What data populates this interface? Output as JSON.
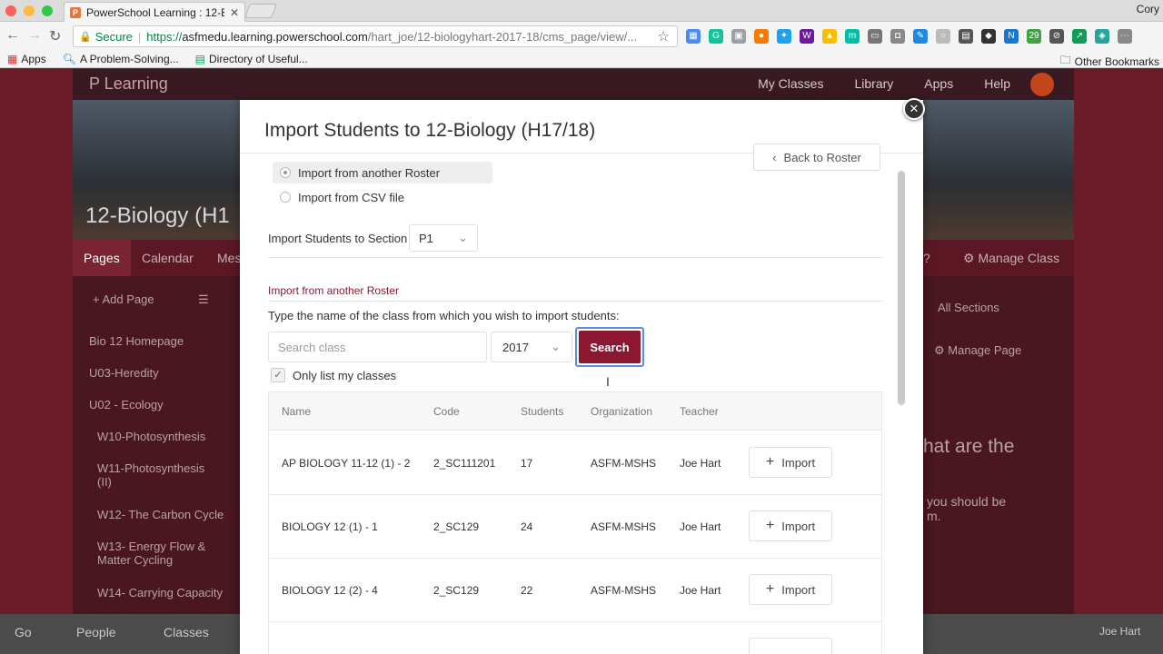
{
  "browser": {
    "tab_title": "PowerSchool Learning : 12-Bi",
    "tab_favicon": "P",
    "user": "Cory",
    "secure_label": "Secure",
    "url_proto": "https://",
    "url_host": "asfmedu.learning.powerschool.com",
    "url_path": "/hart_joe/12-biologyhart-2017-18/cms_page/view/...",
    "bookmarks": [
      "Apps",
      "A Problem-Solving...",
      "Directory of Useful..."
    ],
    "other_bookmarks": "Other Bookmarks",
    "extensions": [
      {
        "icon": "calendar-ext-icon",
        "color": "#4a8af4",
        "glyph": "▦"
      },
      {
        "icon": "grammarly-icon",
        "color": "#15c39a",
        "glyph": "G"
      },
      {
        "icon": "ext-grey-icon",
        "color": "#9aa0a6",
        "glyph": "▣"
      },
      {
        "icon": "ext-orange-icon",
        "color": "#f57c00",
        "glyph": "●"
      },
      {
        "icon": "twitter-icon",
        "color": "#1da1f2",
        "glyph": "✦"
      },
      {
        "icon": "ext-purple-icon",
        "color": "#6a1b9a",
        "glyph": "W"
      },
      {
        "icon": "drive-icon",
        "color": "#fbbc04",
        "glyph": "▲"
      },
      {
        "icon": "ext-teal-icon",
        "color": "#00bfa5",
        "glyph": "m"
      },
      {
        "icon": "cast-icon",
        "color": "#777777",
        "glyph": "▭"
      },
      {
        "icon": "pocket-icon",
        "color": "#888888",
        "glyph": "◘"
      },
      {
        "icon": "ext-blue-icon",
        "color": "#1e88e5",
        "glyph": "✎"
      },
      {
        "icon": "ext-circle-icon",
        "color": "#bbbbbb",
        "glyph": "○"
      },
      {
        "icon": "ext-film-icon",
        "color": "#555555",
        "glyph": "▤"
      },
      {
        "icon": "ext-dark-icon",
        "color": "#333333",
        "glyph": "◆"
      },
      {
        "icon": "ext-new-icon",
        "color": "#1976d2",
        "glyph": "N"
      },
      {
        "icon": "ext-calendar29-icon",
        "color": "#43a047",
        "glyph": "29"
      },
      {
        "icon": "ext-compass-icon",
        "color": "#555555",
        "glyph": "⊘"
      },
      {
        "icon": "ext-green-icon",
        "color": "#0f9d58",
        "glyph": "↗"
      },
      {
        "icon": "ext-diamond-icon",
        "color": "#26a69a",
        "glyph": "◈"
      },
      {
        "icon": "ext-more-icon",
        "color": "#888888",
        "glyph": "⋯"
      }
    ]
  },
  "site": {
    "logo": "Learning",
    "nav": [
      "My Classes",
      "Library",
      "Apps",
      "Help"
    ],
    "course_title": "12-Biology (H1",
    "subnav": [
      "Pages",
      "Calendar",
      "Mes",
      "?",
      "Manage Class"
    ],
    "sidebar": {
      "add_page": "Add Page",
      "items": [
        "Bio 12 Homepage",
        "U03-Heredity",
        "U02 - Ecology",
        "W10-Photosynthesis",
        "W11-Photosynthesis (II)",
        "W12- The Carbon Cycle",
        "W13- Energy Flow & Matter Cycling",
        "W14- Carrying Capacity"
      ]
    },
    "right_panel": {
      "sections": "All Sections",
      "manage_page": "Manage Page",
      "text1": "hat are the",
      "text2": "you should be",
      "text3": "m."
    },
    "bottom": {
      "go": "Go",
      "people": "People",
      "classes": "Classes",
      "user": "Joe Hart"
    }
  },
  "modal": {
    "title": "Import Students to 12-Biology (H17/18)",
    "options": [
      "Import from another Roster",
      "Import from CSV file"
    ],
    "selected_option": 0,
    "back_to_roster": "Back to Roster",
    "section_label": "Import Students to Section",
    "section_value": "P1",
    "sub_heading": "Import from another Roster",
    "instruction": "Type the name of the class from which you wish to import students:",
    "search_placeholder": "Search class",
    "year": "2017",
    "search_button": "Search",
    "only_my_classes": "Only list my classes",
    "only_my_classes_checked": true,
    "columns": [
      "Name",
      "Code",
      "Students",
      "Organization",
      "Teacher"
    ],
    "rows": [
      {
        "name": "AP BIOLOGY 11-12 (1) - 2",
        "code": "2_SC111201",
        "students": "17",
        "org": "ASFM-MSHS",
        "teacher": "Joe Hart"
      },
      {
        "name": "BIOLOGY 12 (1) - 1",
        "code": "2_SC129",
        "students": "24",
        "org": "ASFM-MSHS",
        "teacher": "Joe Hart"
      },
      {
        "name": "BIOLOGY 12 (2) - 4",
        "code": "2_SC129",
        "students": "22",
        "org": "ASFM-MSHS",
        "teacher": "Joe Hart"
      }
    ],
    "import_label": "Import"
  },
  "colors": {
    "brand": "#8b1830",
    "focus": "#5b8ee6",
    "secure": "#0b8043"
  }
}
